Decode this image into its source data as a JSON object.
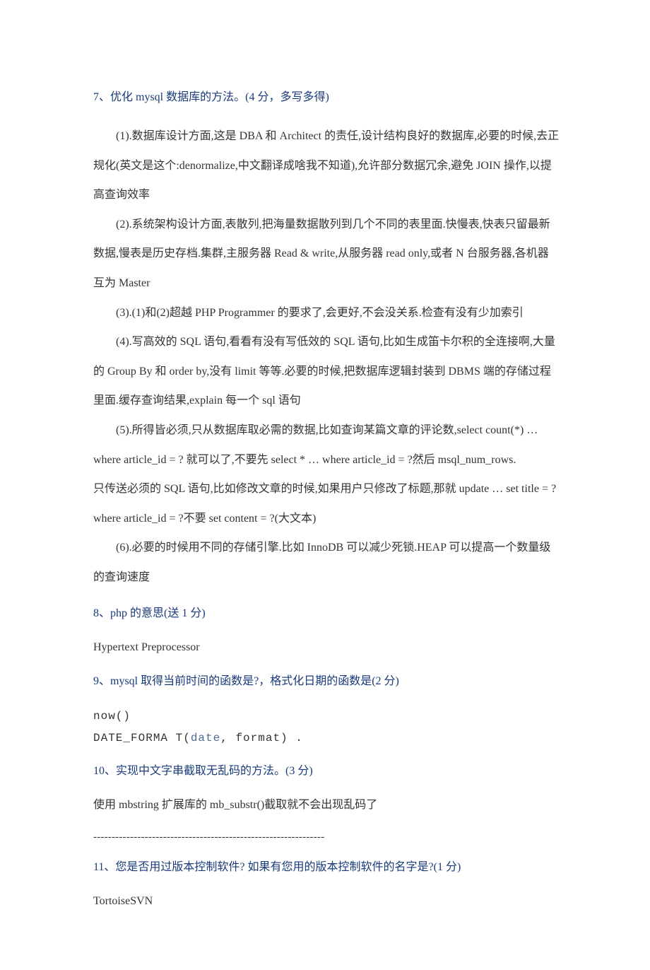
{
  "q7": {
    "title": "7、优化 mysql 数据库的方法。(4 分，多写多得)",
    "p1": "(1).数据库设计方面,这是 DBA 和 Architect 的责任,设计结构良好的数据库,必要的时候,去正",
    "p1b": "规化(英文是这个:denormalize,中文翻译成啥我不知道),允许部分数据冗余,避免 JOIN 操作,以提",
    "p1c": "高查询效率",
    "p2": "(2).系统架构设计方面,表散列,把海量数据散列到几个不同的表里面.快慢表,快表只留最新",
    "p2b": "数据,慢表是历史存档.集群,主服务器 Read & write,从服务器 read only,或者 N 台服务器,各机器",
    "p2c": "互为 Master",
    "p3": "(3).(1)和(2)超越 PHP Programmer 的要求了,会更好,不会没关系.检查有没有少加索引",
    "p4": "(4).写高效的 SQL 语句,看看有没有写低效的 SQL 语句,比如生成笛卡尔积的全连接啊,大量",
    "p4b": "的 Group By 和 order by,没有 limit 等等.必要的时候,把数据库逻辑封装到 DBMS 端的存储过程",
    "p4c": "里面.缓存查询结果,explain 每一个 sql 语句",
    "p5": "(5).所得皆必须,只从数据库取必需的数据,比如查询某篇文章的评论数,select count(*) …",
    "p5b": "where article_id = ?  就可以了,不要先 select * … where article_id = ?然后 msql_num_rows.",
    "p5c": "只传送必须的 SQL 语句,比如修改文章的时候,如果用户只修改了标题,那就 update … set title = ?",
    "p5d": "where article_id = ?不要 set content = ?(大文本)",
    "p6": "(6).必要的时候用不同的存储引擎.比如 InnoDB 可以减少死锁.HEAP 可以提高一个数量级",
    "p6b": "的查询速度"
  },
  "q8": {
    "title": "8、php 的意思(送 1 分)",
    "answer": "Hypertext Preprocessor"
  },
  "q9": {
    "title": "9、mysql 取得当前时间的函数是?，格式化日期的函数是(2 分)",
    "code1": "now()",
    "code2a": "DATE_FORMA T(",
    "code2b": "date",
    "code2c": ", format) ."
  },
  "q10": {
    "title": "10、实现中文字串截取无乱码的方法。(3 分)",
    "answer": "使用 mbstring 扩展库的 mb_substr()截取就不会出现乱码了"
  },
  "divider": "---------------------------------------------------------------",
  "q11": {
    "title": "11、您是否用过版本控制软件? 如果有您用的版本控制软件的名字是?(1 分)",
    "answer": "TortoiseSVN"
  }
}
